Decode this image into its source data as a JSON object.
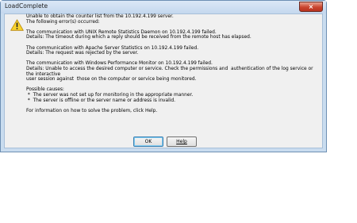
{
  "window": {
    "title": "LoadComplete",
    "close_label": "×"
  },
  "icon": "warning-icon",
  "message_lines": [
    "Unable to obtain the counter list from the 10.192.4.199 server.",
    "The following error(s) occurred:",
    "",
    "The communication with UNIX Remote Statistics Daemon on 10.192.4.199 failed.",
    "Details: The timeout during which a reply should be received from the remote host has elapsed.",
    "",
    "The communication with Apache Server Statistics on 10.192.4.199 failed.",
    "Details: The request was rejected by the server.",
    "",
    "The communication with Windows Performance Monitor on 10.192.4.199 failed.",
    "Details: Unable to access the desired computer or service. Check the permissions and  authentication of the log service or the interactive",
    "user session against  those on the computer or service being monitored.",
    "",
    "Possible causes:",
    " *  The server was not set up for monitoring in the appropriate manner.",
    " *  The server is offline or the server name or address is invalid.",
    "",
    "For information on how to solve the problem, click Help."
  ],
  "buttons": {
    "ok_label": "OK",
    "help_label": "Help"
  }
}
